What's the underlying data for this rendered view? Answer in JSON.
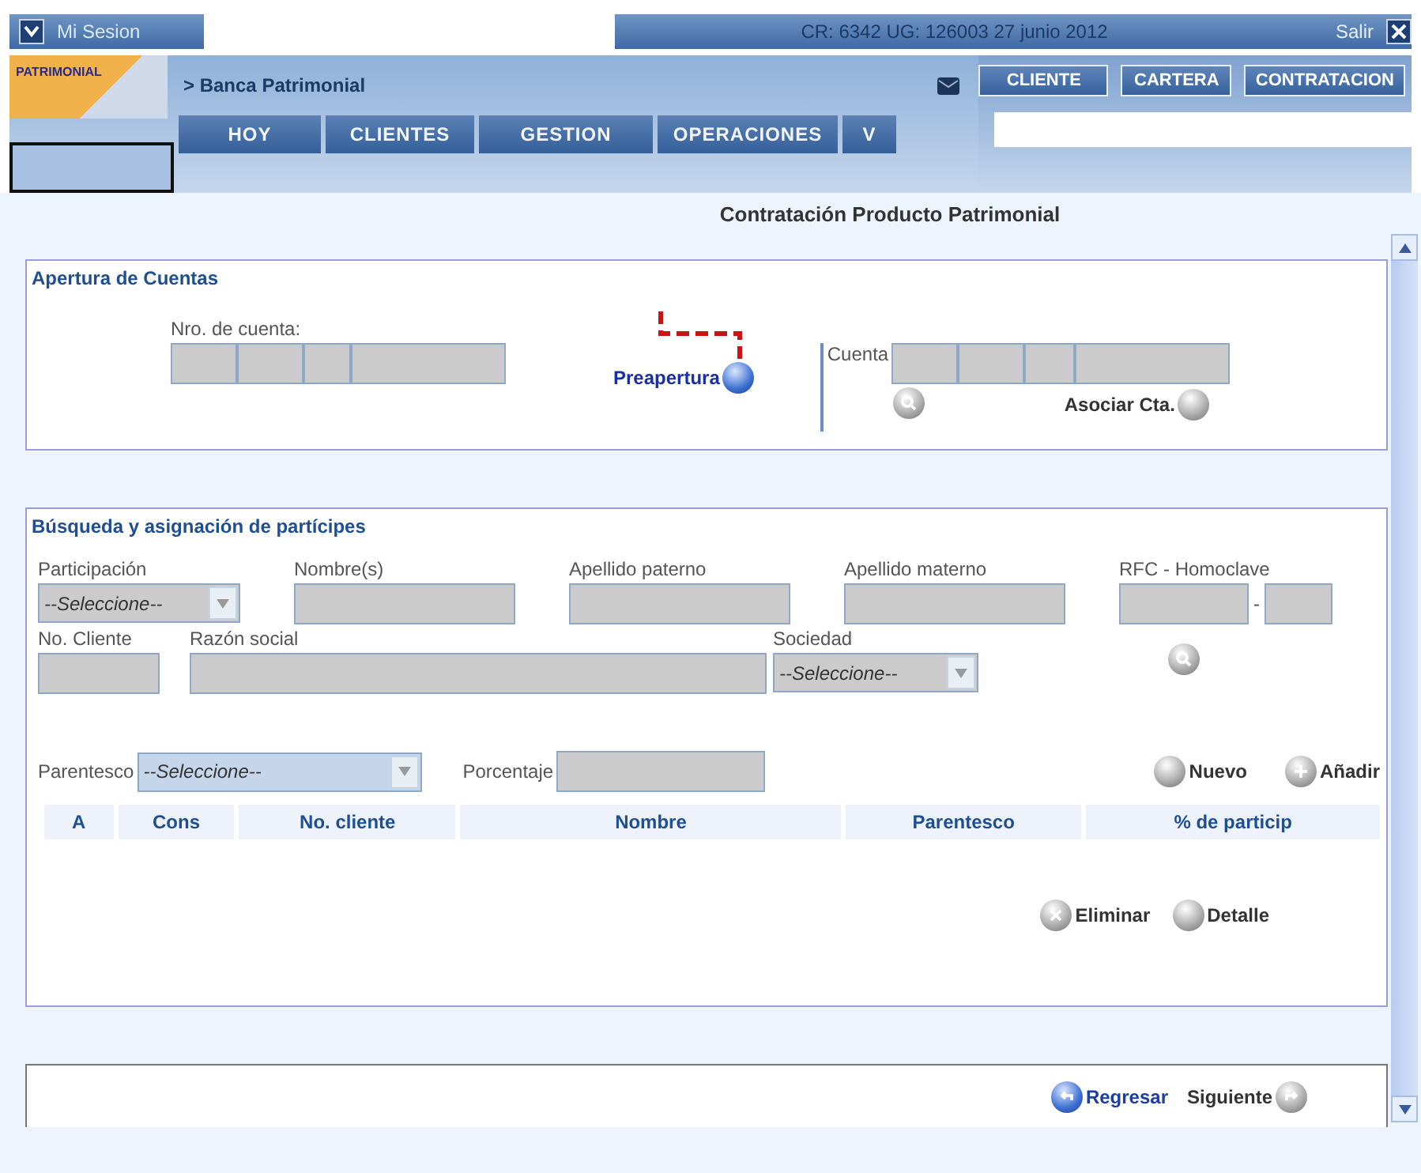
{
  "top_bar": {
    "menu_label": "Mi Sesion",
    "info": "CR: 6342   UG: 126003 27 junio 2012",
    "logout": "Salir"
  },
  "header": {
    "logo": "PATRIMONIAL",
    "breadcrumb": "> Banca Patrimonial",
    "buttons": [
      "CLIENTE",
      "CARTERA",
      "CONTRATACION"
    ]
  },
  "nav_tabs": [
    {
      "label": "HOY"
    },
    {
      "label": "CLIENTES"
    },
    {
      "label": "GESTION"
    },
    {
      "label": "OPERACIONES"
    },
    {
      "label": "V"
    }
  ],
  "page_title": "Contratación Producto Patrimonial",
  "apertura": {
    "title": "Apertura de Cuentas",
    "account_label": "Nro. de cuenta:",
    "preapertura": "Preapertura",
    "cuenta_label": "Cuenta",
    "asociar": "Asociar Cta."
  },
  "busqueda": {
    "title": "Búsqueda y asignación de partícipes",
    "row_1": [
      {
        "label": "Participación",
        "kind": "select",
        "value": "--Seleccione--"
      },
      {
        "label": "Nombre(s)",
        "kind": "text"
      },
      {
        "label": "Apellido paterno",
        "kind": "text"
      },
      {
        "label": "Apellido materno",
        "kind": "text"
      },
      {
        "label": "RFC - Homoclave",
        "kind": "split",
        "separator": "-"
      }
    ],
    "row_2": [
      {
        "label": "No. Cliente",
        "kind": "text"
      },
      {
        "label": "Razón social",
        "kind": "text"
      },
      {
        "label": "Sociedad",
        "kind": "select",
        "value": "--Seleccione--"
      }
    ],
    "parentesco": {
      "label": "Parentesco",
      "value": "--Seleccione--"
    },
    "porcentaje": {
      "label": "Porcentaje"
    },
    "actions": [
      "Nuevo",
      "Añadir"
    ],
    "columns": [
      "A",
      "Cons",
      "No. cliente",
      "Nombre",
      "Parentesco",
      "% de particip"
    ],
    "table_actions": [
      "Eliminar",
      "Detalle"
    ]
  },
  "footer": {
    "back": "Regresar",
    "next": "Siguiente"
  }
}
